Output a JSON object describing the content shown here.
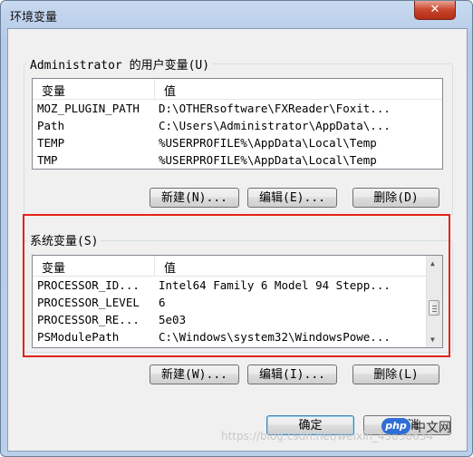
{
  "window": {
    "title": "环境变量",
    "close_glyph": "✕"
  },
  "user_section": {
    "label": "Administrator 的用户变量(U)",
    "columns": [
      "变量",
      "值"
    ],
    "rows": [
      {
        "name": "MOZ_PLUGIN_PATH",
        "value": "D:\\OTHERsoftware\\FXReader\\Foxit..."
      },
      {
        "name": "Path",
        "value": "C:\\Users\\Administrator\\AppData\\..."
      },
      {
        "name": "TEMP",
        "value": "%USERPROFILE%\\AppData\\Local\\Temp"
      },
      {
        "name": "TMP",
        "value": "%USERPROFILE%\\AppData\\Local\\Temp"
      }
    ],
    "buttons": {
      "new": "新建(N)...",
      "edit": "编辑(E)...",
      "delete": "删除(D)"
    }
  },
  "system_section": {
    "label": "系统变量(S)",
    "columns": [
      "变量",
      "值"
    ],
    "rows": [
      {
        "name": "PROCESSOR_ID...",
        "value": "Intel64 Family 6 Model 94 Stepp..."
      },
      {
        "name": "PROCESSOR_LEVEL",
        "value": "6"
      },
      {
        "name": "PROCESSOR_RE...",
        "value": "5e03"
      },
      {
        "name": "PSModulePath",
        "value": "C:\\Windows\\system32\\WindowsPowe..."
      }
    ],
    "buttons": {
      "new": "新建(W)...",
      "edit": "编辑(I)...",
      "delete": "删除(L)"
    },
    "highlight_color": "#e2231a"
  },
  "footer": {
    "ok": "确定",
    "cancel": "取消"
  },
  "watermark": {
    "url": "https://blog.csdn.net/weixin_43838634",
    "logo_badge": "php",
    "logo_text": "中文网"
  },
  "icons": [
    "close-icon",
    "scroll-up-icon",
    "scroll-down-icon",
    "scroll-grip-icon"
  ]
}
